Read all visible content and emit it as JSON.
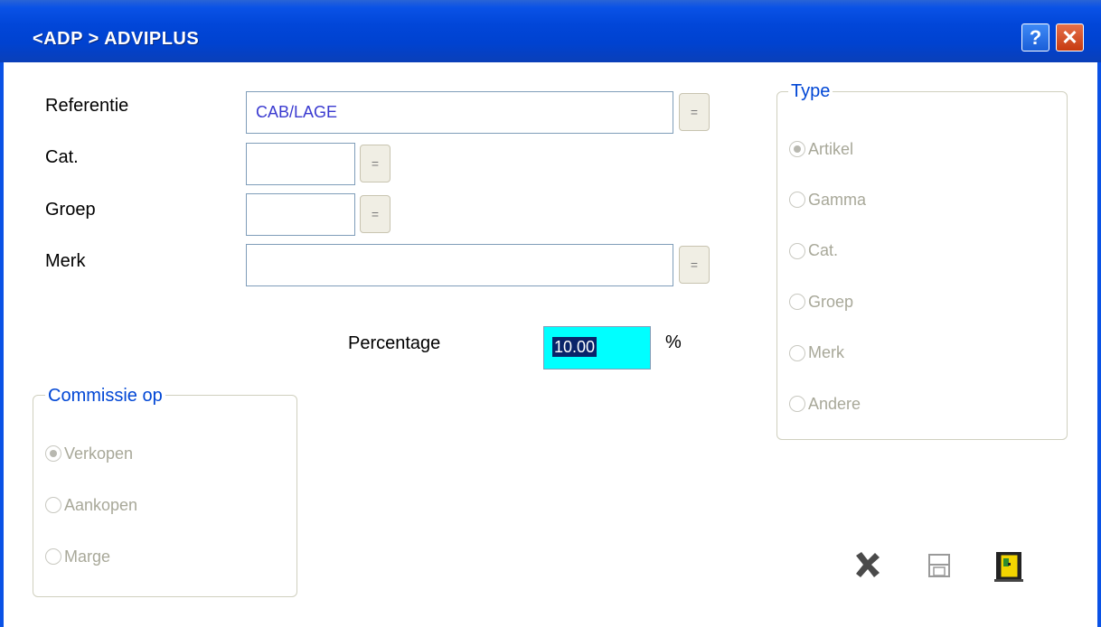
{
  "window": {
    "title": "<ADP > ADVIPLUS",
    "help_icon": "?",
    "close_icon": "✕"
  },
  "form": {
    "referentie_label": "Referentie",
    "referentie_value": "CAB/LAGE",
    "cat_label": "Cat.",
    "cat_value": "",
    "groep_label": "Groep",
    "groep_value": "",
    "merk_label": "Merk",
    "merk_value": "",
    "lookup_label": "=",
    "percentage_label": "Percentage",
    "percentage_value": "10.00",
    "percentage_unit": "%"
  },
  "type_group": {
    "legend": "Type",
    "options": [
      "Artikel",
      "Gamma",
      "Cat.",
      "Groep",
      "Merk",
      "Andere"
    ],
    "selected": "Artikel"
  },
  "commissie_group": {
    "legend": "Commissie op",
    "options": [
      "Verkopen",
      "Aankopen",
      "Marge"
    ],
    "selected": "Verkopen"
  },
  "toolbar": {
    "cancel_icon": "x-icon",
    "save_icon": "floppy-disk-icon",
    "exit_icon": "door-icon"
  },
  "colors": {
    "titlebar": "#0146d8",
    "legend_text": "#0046d5",
    "percentage_bg": "#00ffff",
    "selection_bg": "#0a246a"
  }
}
